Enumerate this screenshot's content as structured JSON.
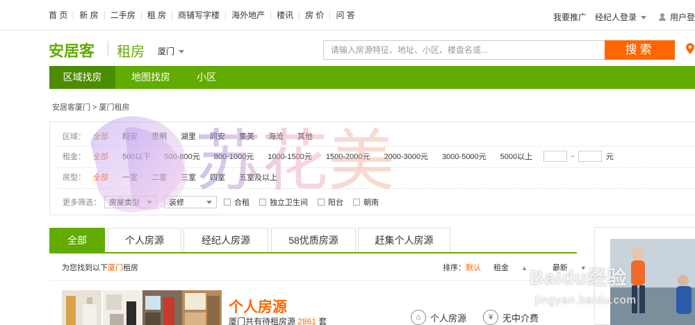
{
  "topnav": {
    "links": [
      "首 页",
      "新 房",
      "二手房",
      "租 房",
      "商铺写字楼",
      "海外地产",
      "楼讯",
      "房 价",
      "问 答"
    ],
    "promote": "我要推广",
    "agent_login": "经纪人登录",
    "user_center": "用户登"
  },
  "header": {
    "logo": "安居客",
    "section": "租房",
    "city": "厦门",
    "search_placeholder": "请输入房源特征、地址、小区、楼盘名或...",
    "search_button": "搜索"
  },
  "greennav": [
    "区域找房",
    "地图找房",
    "小区"
  ],
  "breadcrumb": "安居客厦门 > 厦门租房",
  "filters": {
    "area": {
      "label": "区域：",
      "options": [
        "全部",
        "翔安",
        "思明",
        "湖里",
        "同安",
        "集美",
        "海沧",
        "其他"
      ]
    },
    "rent": {
      "label": "租金：",
      "options": [
        "全部",
        "500以下",
        "500-800元",
        "800-1000元",
        "1000-1500元",
        "1500-2000元",
        "2000-3000元",
        "3000-5000元",
        "5000以上"
      ],
      "dash": "-",
      "unit": "元"
    },
    "layout": {
      "label": "房型：",
      "options": [
        "全部",
        "一室",
        "二室",
        "三室",
        "四室",
        "五室及以上"
      ]
    },
    "more": {
      "label": "更多筛选：",
      "selects": [
        "房屋类型",
        "装修"
      ],
      "checks": [
        "合租",
        "独立卫生间",
        "阳台",
        "朝南"
      ]
    }
  },
  "tabs": [
    "全部",
    "个人房源",
    "经纪人房源",
    "58优质房源",
    "赶集个人房源"
  ],
  "result": {
    "prefix": "为您找到以下",
    "city": "厦门",
    "suffix": "租房"
  },
  "sort": {
    "label": "排序：",
    "default": "默认",
    "rent": "租金",
    "newest": "最新"
  },
  "card": {
    "title": "个人房源",
    "sub_prefix": "厦门共有待租房源",
    "count": "2861",
    "sub_suffix": "套",
    "features": [
      {
        "icon": "house-icon",
        "label": "个人房源"
      },
      {
        "icon": "yen-icon",
        "label": "无中介费"
      }
    ]
  },
  "watermark": {
    "text": "苏花美",
    "baidu": "Baidu经验",
    "url": "jingyan.baidu.com"
  },
  "colors": {
    "brand_green": "#62ab00",
    "accent_orange": "#ff6600"
  }
}
